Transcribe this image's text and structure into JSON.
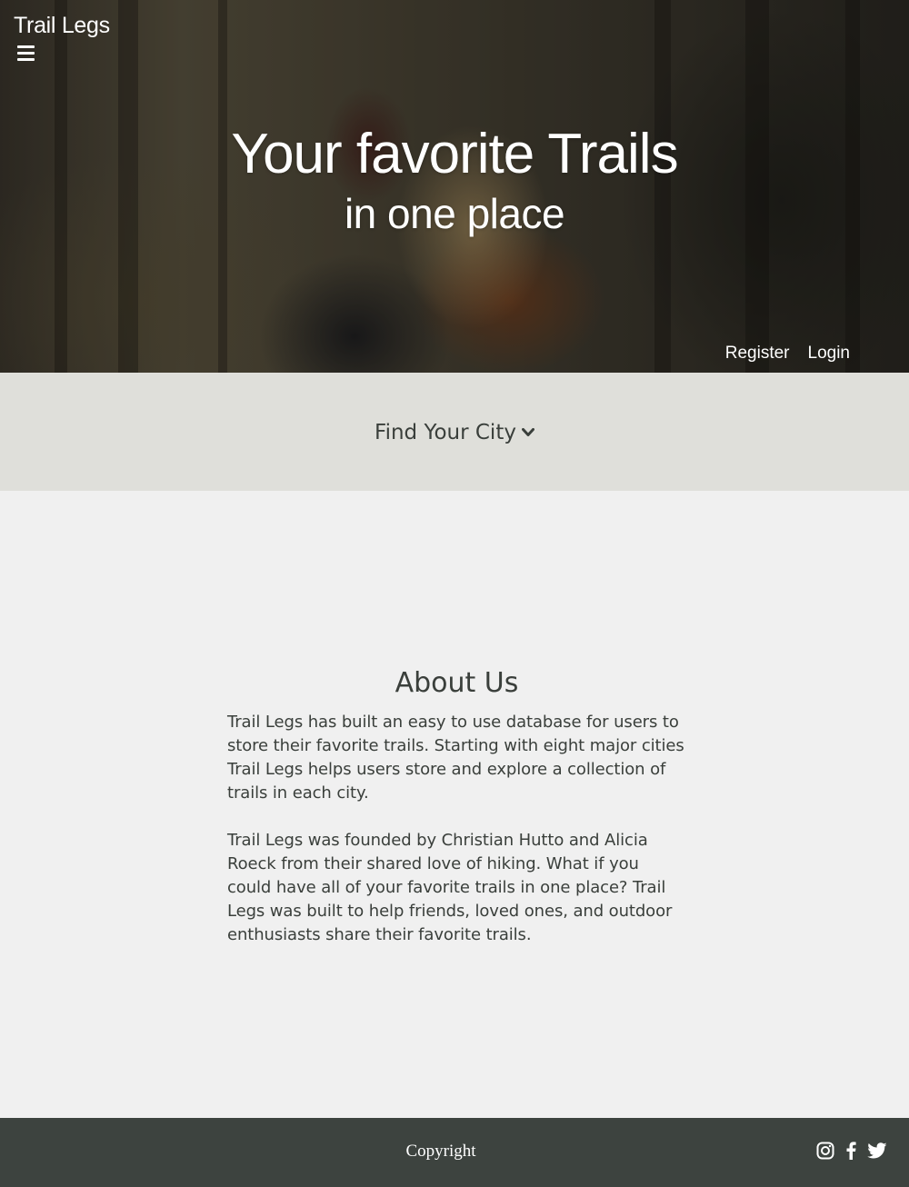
{
  "header": {
    "brand": "Trail Legs",
    "menu_icon": "hamburger-menu-icon",
    "title_line1": "Your favorite Trails",
    "title_line2": "in one place",
    "nav": {
      "register": "Register",
      "login": "Login"
    }
  },
  "city_selector": {
    "label": "Find Your City",
    "icon": "chevron-down-icon"
  },
  "about": {
    "title": "About Us",
    "paragraphs": [
      "Trail Legs has built an easy to use database for users to store their favorite trails. Starting with eight major cities Trail Legs helps users store and explore a collection of trails in each city.",
      "Trail Legs was founded by Christian Hutto and Alicia Roeck from their shared love of hiking. What if you could have all of your favorite trails in one place? Trail Legs was built to help friends, loved ones, and outdoor enthusiasts share their favorite trails."
    ]
  },
  "footer": {
    "copyright": "Copyright",
    "social_icons": [
      "instagram-icon",
      "facebook-icon",
      "twitter-icon"
    ]
  },
  "colors": {
    "band_bg": "#dfdfda",
    "page_bg": "#f0f0f0",
    "footer_bg": "#3d433f",
    "text": "#3a3f3b"
  }
}
